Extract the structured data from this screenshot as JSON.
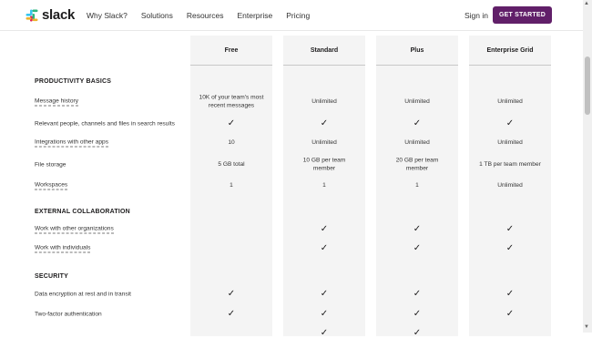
{
  "nav": {
    "logo_text": "slack",
    "links": [
      "Why Slack?",
      "Solutions",
      "Resources",
      "Enterprise",
      "Pricing"
    ],
    "signin": "Sign in",
    "cta": "GET STARTED",
    "cta_color": "#611f69"
  },
  "plans": [
    "Free",
    "Standard",
    "Plus",
    "Enterprise Grid"
  ],
  "sections": {
    "productivity": "PRODUCTIVITY BASICS",
    "external": "EXTERNAL COLLABORATION",
    "security": "SECURITY"
  },
  "rows": [
    {
      "feature": "Message history",
      "cells": [
        "10K of your team's most recent messages",
        "Unlimited",
        "Unlimited",
        "Unlimited"
      ]
    },
    {
      "feature": "Relevant people, channels and files in search results",
      "cells": [
        "check",
        "check",
        "check",
        "check"
      ]
    },
    {
      "feature": "Integrations with other apps",
      "cells": [
        "10",
        "Unlimited",
        "Unlimited",
        "Unlimited"
      ]
    },
    {
      "feature": "File storage",
      "cells": [
        "5 GB total",
        "10 GB per team member",
        "20 GB per team member",
        "1 TB per team member"
      ]
    },
    {
      "feature": "Workspaces",
      "cells": [
        "1",
        "1",
        "1",
        "Unlimited"
      ]
    },
    {
      "feature": "Work with other organizations",
      "cells": [
        "",
        "check",
        "check",
        "check"
      ]
    },
    {
      "feature": "Work with individuals",
      "cells": [
        "",
        "check",
        "check",
        "check"
      ]
    },
    {
      "feature": "Data encryption at rest and in transit",
      "cells": [
        "check",
        "check",
        "check",
        "check"
      ]
    },
    {
      "feature": "Two-factor authentication",
      "cells": [
        "check",
        "check",
        "check",
        "check"
      ]
    }
  ]
}
